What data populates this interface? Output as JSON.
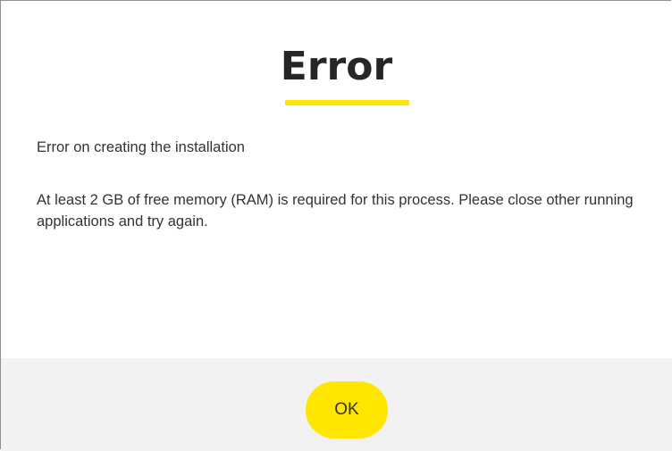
{
  "dialog": {
    "title": "Error",
    "heading": "Error on creating the installation",
    "message": "At least 2 GB of free memory (RAM) is required for this process. Please close other running applications and try again.",
    "ok_label": "OK"
  },
  "colors": {
    "accent": "#ffe600",
    "footer_background": "#f2f2f2",
    "text": "#333333",
    "title_text": "#262626"
  }
}
